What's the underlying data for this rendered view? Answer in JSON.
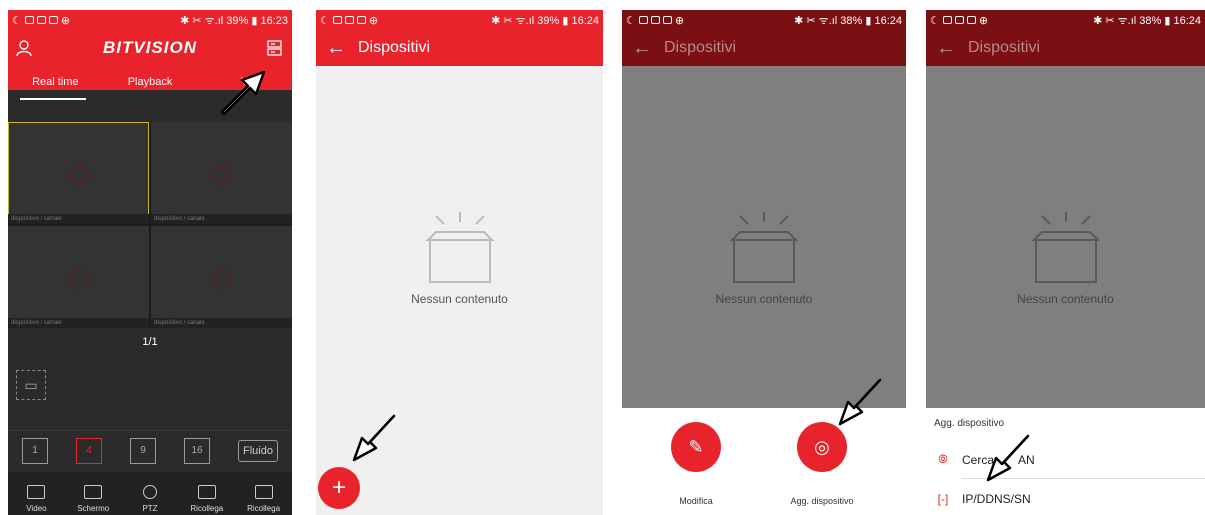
{
  "status": {
    "s1": {
      "right": "✱ ✂ ᯤ.ıl 39% ▮ 16:23"
    },
    "s2": {
      "right": "✱ ✂ ᯤ.ıl 39% ▮ 16:24"
    },
    "s3": {
      "right": "✱ ✂ ᯤ.ıl 38% ▮ 16:24"
    },
    "s4": {
      "right": "✱ ✂ ᯤ.ıl 38% ▮ 16:24"
    }
  },
  "screen1": {
    "brand": "BITVISION",
    "tabs": [
      {
        "label": "Real time"
      },
      {
        "label": "Playback"
      },
      {
        "label": "V"
      }
    ],
    "cell_label": "dispositivo / canale",
    "page": "1/1",
    "layout_buttons": [
      {
        "label": "1"
      },
      {
        "label": "4"
      },
      {
        "label": "9"
      },
      {
        "label": "16"
      }
    ],
    "fluido": "Fluido",
    "nav": [
      {
        "label": "Video"
      },
      {
        "label": "Schermo"
      },
      {
        "label": "PTZ"
      },
      {
        "label": "Ricollega"
      },
      {
        "label": "Ricollega"
      }
    ],
    "colors": {
      "accent": "#e8232b",
      "dark": "#2b2b2b",
      "selected": "#c8b428"
    }
  },
  "screen2": {
    "title": "Dispositivi",
    "empty_text": "Nessun contenuto",
    "fab_label": "+"
  },
  "screen3": {
    "title": "Dispositivi",
    "empty_text": "Nessun contenuto",
    "actions": [
      {
        "label": "Modifica",
        "icon": "edit-icon"
      },
      {
        "label": "Agg. dispositivo",
        "icon": "add-camera-icon"
      }
    ]
  },
  "screen4": {
    "title": "Dispositivi",
    "empty_text": "Nessun contenuto",
    "sheet_title": "Agg. dispositivo",
    "items": [
      {
        "label": "Cerca",
        "label_suffix": "AN",
        "icon": "location-icon"
      },
      {
        "label": "IP/DDNS/SN",
        "icon": "network-icon"
      }
    ]
  }
}
